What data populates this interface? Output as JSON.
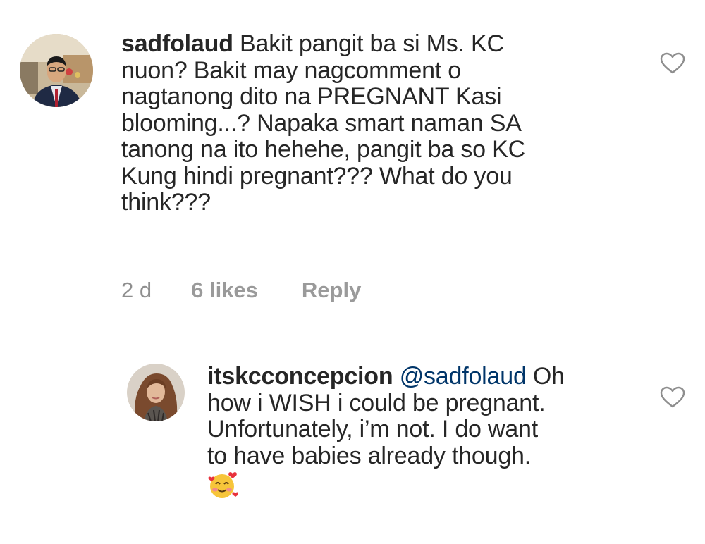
{
  "comments": [
    {
      "username": "sadfolaud",
      "text": "Bakit pangit ba si Ms. KC nuon? Bakit may nagcomment o nagtanong dito na PREGNANT Kasi blooming...? Napaka smart naman SA tanong na ito hehehe, pangit ba so KC Kung hindi pregnant??? What do you think???",
      "lines": [
        "Bakit pangit ba si Ms. KC",
        "nuon? Bakit may nagcomment o",
        "nagtanong dito na PREGNANT Kasi",
        "blooming...? Napaka smart naman SA",
        "tanong na ito hehehe, pangit ba so KC",
        "Kung hindi pregnant??? What do you",
        "think???"
      ],
      "time": "2 d",
      "likes": "6 likes",
      "reply_label": "Reply",
      "like_icon": "heart-outline-icon"
    },
    {
      "username": "itskcconcepcion",
      "mention": "@sadfolaud",
      "lines": [
        "Oh",
        "how i WISH i could be pregnant.",
        "Unfortunately, i’m not. I do want",
        "to have babies already though."
      ],
      "emoji": "smiling-face-with-hearts-icon",
      "like_icon": "heart-outline-icon"
    }
  ],
  "colors": {
    "text": "#262626",
    "meta": "#8e8e8e",
    "mention": "#003569",
    "heart_stroke": "#8e8e8e",
    "background": "#ffffff"
  }
}
